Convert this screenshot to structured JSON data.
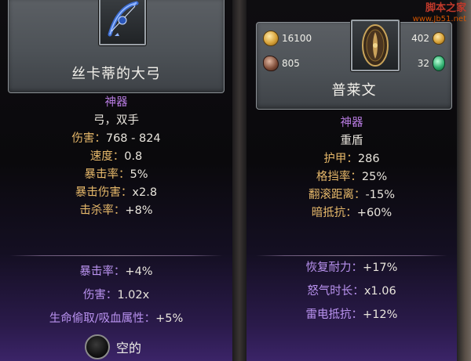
{
  "left_item": {
    "name": "丝卡蒂的大弓",
    "rarity": "神器",
    "type": "弓，双手",
    "stats": [
      {
        "label": "伤害：",
        "value": "768 - 824"
      },
      {
        "label": "速度：",
        "value": "0.8"
      },
      {
        "label": "暴击率：",
        "value": "5%"
      },
      {
        "label": "暴击伤害：",
        "value": "x2.8"
      },
      {
        "label": "击杀率：",
        "value": "+8%"
      }
    ],
    "bonus_stats": [
      {
        "label": "暴击率：",
        "value": "+4%"
      },
      {
        "label": "伤害：",
        "value": "1.02x"
      },
      {
        "label": "生命偷取/吸血属性：",
        "value": "+5%"
      }
    ],
    "socket": {
      "label": "空的",
      "icon": "empty-socket-icon"
    },
    "icon": "bow-icon"
  },
  "right_item": {
    "name": "普莱文",
    "rarity": "神器",
    "type": "重盾",
    "stats": [
      {
        "label": "护甲：",
        "value": "286"
      },
      {
        "label": "格挡率：",
        "value": "25%"
      },
      {
        "label": "翻滚距离：",
        "value": "-15%"
      },
      {
        "label": "暗抵抗：",
        "value": "+60%"
      }
    ],
    "bonus_stats": [
      {
        "label": "恢复耐力：",
        "value": "+17%"
      },
      {
        "label": "怒气时长：",
        "value": "x1.06"
      },
      {
        "label": "雷电抵抗：",
        "value": "+12%"
      }
    ],
    "icon": "shield-icon"
  },
  "currency": {
    "gold": "16100",
    "ore": "805",
    "coins": "402",
    "gems": "32"
  },
  "watermark": {
    "line1": "脚本之家",
    "line2": "www.Jb51.net"
  },
  "colors": {
    "stat_label": "#e6b86a",
    "bonus_label": "#b992ef",
    "rarity": "#b77be0",
    "text": "#e8e4dc"
  }
}
